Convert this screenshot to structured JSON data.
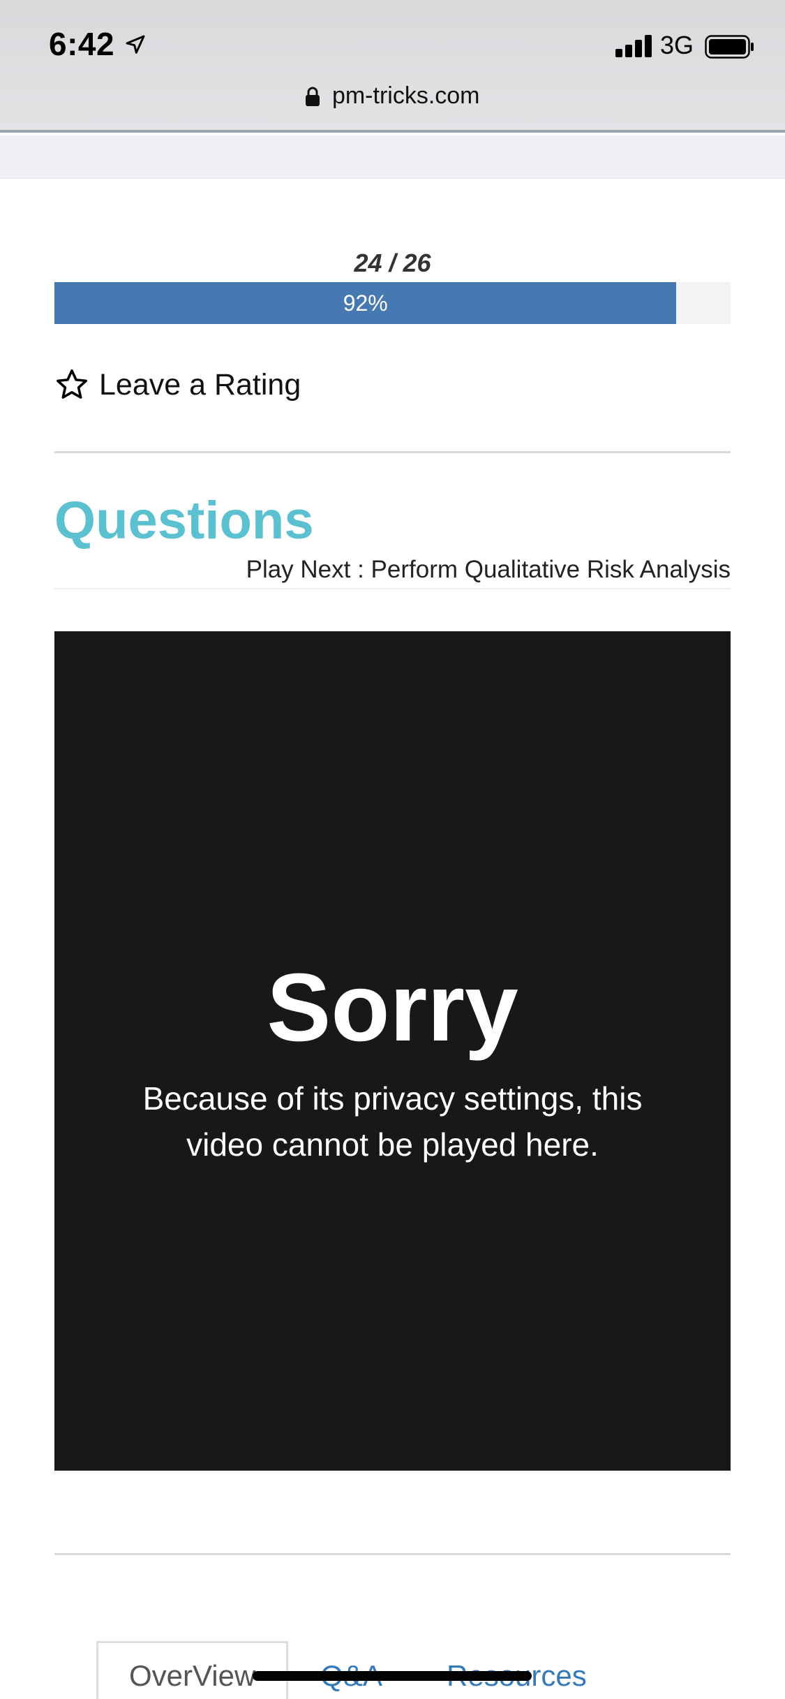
{
  "status_bar": {
    "time": "6:42",
    "network": "3G",
    "icons": [
      "location-arrow-icon",
      "signal-bars-icon",
      "battery-icon"
    ]
  },
  "browser": {
    "url": "pm-tricks.com",
    "lock_icon": "lock-icon"
  },
  "progress": {
    "count": "24 / 26",
    "percent_label": "92%",
    "fraction": 0.92,
    "fill_color": "#4679b2"
  },
  "rating": {
    "icon": "star-outline-icon",
    "label": "Leave a Rating"
  },
  "questions": {
    "heading": "Questions",
    "heading_color": "#5bc0cf",
    "play_next": "Play Next : Perform Qualitative Risk Analysis"
  },
  "video": {
    "background": "#181818",
    "title": "Sorry",
    "message": "Because of its privacy settings, this video cannot be played here."
  },
  "tabs": [
    {
      "label": "OverView",
      "active": true
    },
    {
      "label": "Q&A",
      "active": false
    },
    {
      "label": "Resources",
      "active": false
    }
  ],
  "colors": {
    "link": "#337ab7"
  }
}
